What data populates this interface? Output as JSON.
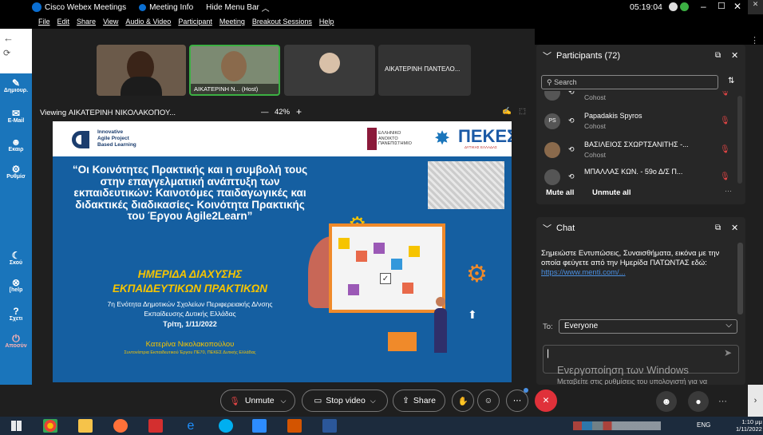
{
  "titlebar": {
    "app_name": "Cisco Webex Meetings",
    "meeting_info": "Meeting Info",
    "hide_menu": "Hide Menu Bar",
    "time": "05:19:04"
  },
  "menubar": [
    "File",
    "Edit",
    "Share",
    "View",
    "Audio & Video",
    "Participant",
    "Meeting",
    "Breakout Sessions",
    "Help"
  ],
  "left_nav": {
    "logo": "sch",
    "items": [
      "Δημιουρ.",
      "E-Mail",
      "Εκαιρ",
      "Ρυθμίσ",
      "Σκού",
      "[help",
      "Σχετι",
      "Αποσύν"
    ]
  },
  "thumbnails": [
    {
      "name": ""
    },
    {
      "name": "ΑΙΚΑΤΕΡΙΝΗ Ν... (Host)"
    },
    {
      "name": ""
    },
    {
      "name": "ΑΙΚΑΤΕΡΙΝΗ ΠΑΝΤΕΛΟ..."
    }
  ],
  "viewing": {
    "label": "Viewing ΑΙΚΑΤΕΡΙΝΗ ΝΙΚΟΛΑΚΟΠΟΥ...",
    "zoom": "42%",
    "minus": "—",
    "plus": "+"
  },
  "slide": {
    "logo_left_lines": [
      "Innovative",
      "Agile Project",
      "Based Learning"
    ],
    "logo_uni": [
      "ΕΛΛΗΝΙΚΟ",
      "ΑΝΟΙΚΤΟ",
      "ΠΑΝΕΠΙΣΤΗΜΙΟ"
    ],
    "logo_pekes": "ΠΕΚΕΣ",
    "logo_pekes_sub": "ΔΥΤΙΚΗΣ ΕΛΛΑΔΑΣ",
    "title": "“Οι Κοινότητες Πρακτικής και η συμβολή τους στην επαγγελματική ανάπτυξη των εκπαιδευτικών: Καινοτόμες παιδαγωγικές και διδακτικές διαδικασίες- Κοινότητα Πρακτικής του Έργου Agile2Learn”",
    "subtitle_line1": "ΗΜΕΡΙΔΑ ΔΙΑΧΥΣΗΣ",
    "subtitle_line2": "ΕΚΠΑΙΔΕΥΤΙΚΩΝ ΠΡΑΚΤΙΚΩΝ",
    "org_line1": "7η Ενότητα Δημοτικών Σχολείων Περιφερειακής Δ/νσης",
    "org_line2": "Εκπαίδευσης Δυτικής Ελλάδας",
    "date": "Τρίτη, 1/11/2022",
    "presenter": "Κατερίνα Νικολακοπούλου",
    "presenter_role": "Συντονίστρια Εκπαιδευτικού Έργου ΠΕ70, ΠΕΚΕΣ Δυτικής Ελλάδας"
  },
  "participants": {
    "header": "Participants (72)",
    "search_placeholder": "Search",
    "list": [
      {
        "initials": "",
        "name": "",
        "role": "Cohost"
      },
      {
        "initials": "PS",
        "name": "Papadakis Spyros",
        "role": "Cohost"
      },
      {
        "initials": "",
        "name": "ΒΑΣΙΛΕΙΟΣ ΣΧΩΡΤΣΑΝΙΤΗΣ -...",
        "role": "Cohost"
      },
      {
        "initials": "",
        "name": "ΜΠΑΛΛΑΣ ΚΩΝ. - 59ο Δ/Σ Π...",
        "role": "Cohost"
      }
    ],
    "mute_all": "Mute all",
    "unmute_all": "Unmute all"
  },
  "chat": {
    "header": "Chat",
    "message": "Σημειώστε Εντυπώσεις, Συναισθήματα, εικόνα με την οποία φεύγετε από την Ημερίδα ΠΑΤΩΝΤΑΣ εδώ:",
    "link": "https://www.menti.com/...",
    "to_label": "To:",
    "to_value": "Everyone",
    "watermark_title": "Ενεργοποίηση των Windows",
    "watermark_text": "Μεταβείτε στις ρυθμίσεις του υπολογιστή για να ενεργοποιήσετε τα Windows."
  },
  "controls": {
    "unmute": "Unmute",
    "stop_video": "Stop video",
    "share": "Share"
  },
  "taskbar": {
    "lang": "ENG",
    "time": "1:10 μμ",
    "date": "1/11/2022"
  },
  "colors": {
    "slide_blue": "#155fa1",
    "accent_yellow": "#f6c400",
    "end_red": "#e0313a"
  }
}
